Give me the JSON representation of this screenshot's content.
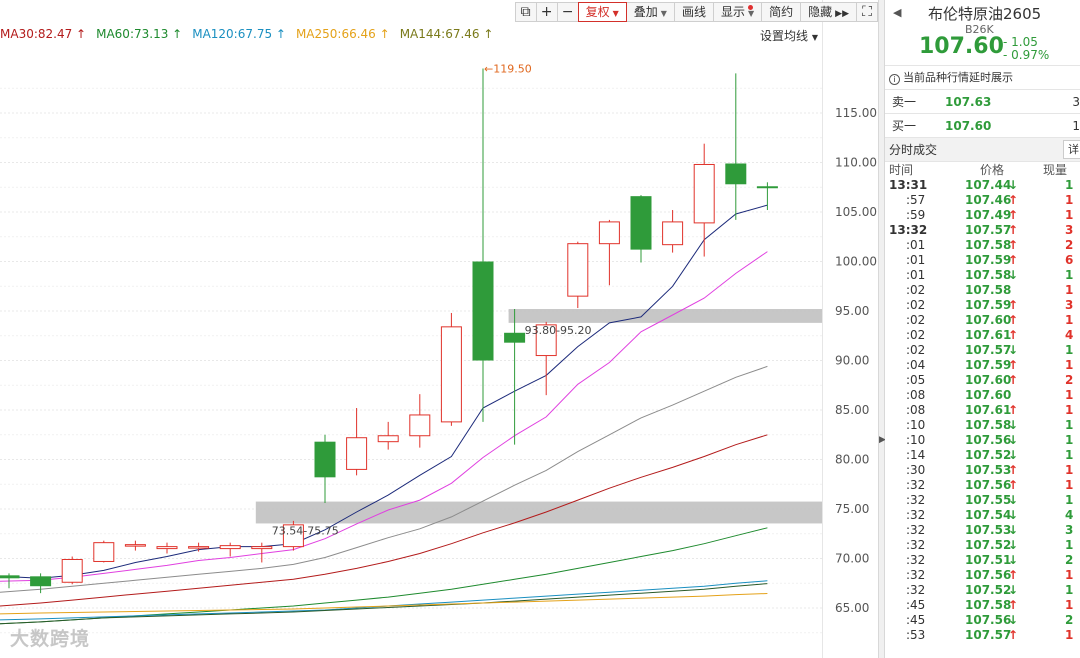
{
  "toolbar": {
    "buttons": [
      "复权",
      "叠加",
      "画线",
      "显示",
      "简约",
      "隐藏"
    ],
    "icons": [
      "copy-icon",
      "zoom-in-icon",
      "zoom-out-icon",
      "double-chevron-right-icon",
      "fullscreen-icon"
    ]
  },
  "ma_legend": [
    {
      "label": "MA30:82.47",
      "arrow": "↑",
      "color": "#b31b1b"
    },
    {
      "label": "MA60:73.13",
      "arrow": "↑",
      "color": "#1e8a2e"
    },
    {
      "label": "MA120:67.75",
      "arrow": "↑",
      "color": "#1a8fc0"
    },
    {
      "label": "MA250:66.46",
      "arrow": "↑",
      "color": "#e4a21a"
    },
    {
      "label": "MA144:67.46",
      "arrow": "↑",
      "color": "#7a7a1a"
    }
  ],
  "ma_settings_label": "设置均线",
  "collapse_glyph": "▶",
  "chart_data": {
    "type": "candlestick",
    "ylim": [
      62,
      122
    ],
    "y_ticks": [
      "115.00",
      "110.00",
      "105.00",
      "100.00",
      "95.00",
      "90.00",
      "85.00",
      "80.00",
      "75.00",
      "70.00",
      "65.00"
    ],
    "y_tick_values": [
      115,
      110,
      105,
      100,
      95,
      90,
      85,
      80,
      75,
      70,
      65
    ],
    "high_annotation": {
      "label": "119.50",
      "arrow": "←",
      "index": 14
    },
    "zones": [
      {
        "label": "93.80-95.20",
        "low": 93.8,
        "high": 95.2,
        "start_index": 16
      },
      {
        "label": "73.54-75.75",
        "low": 73.54,
        "high": 75.75,
        "start_index": 8
      }
    ],
    "candles": [
      {
        "o": 68.3,
        "h": 68.5,
        "l": 67.0,
        "c": 68.0
      },
      {
        "o": 68.2,
        "h": 68.5,
        "l": 66.5,
        "c": 67.2
      },
      {
        "o": 67.6,
        "h": 70.2,
        "l": 67.4,
        "c": 69.9
      },
      {
        "o": 69.7,
        "h": 71.8,
        "l": 69.6,
        "c": 71.6
      },
      {
        "o": 71.4,
        "h": 71.8,
        "l": 70.8,
        "c": 71.4
      },
      {
        "o": 71.0,
        "h": 71.6,
        "l": 70.5,
        "c": 71.2
      },
      {
        "o": 71.1,
        "h": 71.6,
        "l": 70.7,
        "c": 71.2
      },
      {
        "o": 71.0,
        "h": 71.6,
        "l": 70.2,
        "c": 71.3
      },
      {
        "o": 71.0,
        "h": 71.6,
        "l": 69.6,
        "c": 71.2
      },
      {
        "o": 71.2,
        "h": 73.8,
        "l": 70.8,
        "c": 73.4
      },
      {
        "o": 81.8,
        "h": 82.5,
        "l": 75.6,
        "c": 78.2
      },
      {
        "o": 79.0,
        "h": 85.2,
        "l": 78.4,
        "c": 82.2
      },
      {
        "o": 81.8,
        "h": 83.8,
        "l": 81.0,
        "c": 82.4
      },
      {
        "o": 82.4,
        "h": 86.6,
        "l": 81.2,
        "c": 84.5
      },
      {
        "o": 83.8,
        "h": 94.8,
        "l": 83.4,
        "c": 93.4
      },
      {
        "o": 100.0,
        "h": 119.5,
        "l": 83.8,
        "c": 90.0
      },
      {
        "o": 92.8,
        "h": 95.2,
        "l": 81.5,
        "c": 91.8
      },
      {
        "o": 90.5,
        "h": 93.9,
        "l": 86.5,
        "c": 93.6
      },
      {
        "o": 96.5,
        "h": 102.0,
        "l": 95.3,
        "c": 101.8
      },
      {
        "o": 101.8,
        "h": 104.2,
        "l": 97.6,
        "c": 104.0
      },
      {
        "o": 106.6,
        "h": 106.7,
        "l": 99.9,
        "c": 101.2
      },
      {
        "o": 101.7,
        "h": 105.2,
        "l": 100.9,
        "c": 104.0
      },
      {
        "o": 103.9,
        "h": 111.9,
        "l": 100.5,
        "c": 109.8
      },
      {
        "o": 109.9,
        "h": 119.0,
        "l": 104.2,
        "c": 107.8
      },
      {
        "o": 107.6,
        "h": 108.0,
        "l": 105.2,
        "c": 107.4
      }
    ],
    "ma_lines": [
      {
        "name": "MA5",
        "color": "#1c2a7a",
        "values": [
          68.2,
          68.0,
          68.3,
          68.8,
          69.6,
          70.2,
          70.9,
          71.2,
          71.2,
          71.5,
          72.9,
          74.7,
          76.4,
          78.4,
          80.3,
          85.2,
          86.9,
          88.5,
          91.4,
          93.8,
          94.4,
          97.5,
          102.2,
          104.8,
          105.7
        ]
      },
      {
        "name": "MA10",
        "color": "#e040e0",
        "values": [
          67.7,
          67.8,
          68.1,
          68.5,
          68.9,
          69.3,
          69.8,
          70.1,
          70.5,
          70.9,
          72.0,
          73.5,
          74.9,
          75.9,
          77.6,
          80.2,
          82.4,
          84.3,
          87.6,
          89.8,
          92.9,
          94.6,
          96.3,
          98.8,
          101.0
        ]
      },
      {
        "name": "MA20",
        "color": "#8c8c8c",
        "values": [
          66.6,
          66.9,
          67.2,
          67.5,
          67.8,
          68.1,
          68.4,
          68.7,
          69.0,
          69.4,
          70.1,
          71.1,
          72.1,
          73.0,
          74.2,
          75.8,
          77.4,
          78.9,
          80.8,
          82.5,
          84.2,
          85.5,
          86.9,
          88.3,
          89.4
        ]
      },
      {
        "name": "MA30",
        "color": "#b31b1b",
        "values": [
          65.2,
          65.5,
          65.8,
          66.1,
          66.4,
          66.7,
          67.0,
          67.3,
          67.6,
          67.9,
          68.4,
          69.0,
          69.7,
          70.5,
          71.5,
          72.6,
          73.6,
          74.7,
          75.9,
          77.1,
          78.2,
          79.2,
          80.3,
          81.5,
          82.5
        ]
      },
      {
        "name": "MA60",
        "color": "#1e8a2e",
        "values": [
          63.4,
          63.6,
          63.8,
          64.0,
          64.2,
          64.4,
          64.6,
          64.8,
          65.0,
          65.2,
          65.5,
          65.8,
          66.1,
          66.5,
          66.9,
          67.4,
          67.9,
          68.4,
          69.0,
          69.6,
          70.2,
          70.8,
          71.5,
          72.3,
          73.1
        ]
      },
      {
        "name": "MA120",
        "color": "#1a8fc0",
        "values": [
          63.8,
          63.9,
          64.0,
          64.1,
          64.2,
          64.3,
          64.4,
          64.5,
          64.6,
          64.7,
          64.8,
          65.0,
          65.2,
          65.4,
          65.6,
          65.8,
          66.0,
          66.2,
          66.4,
          66.6,
          66.8,
          67.0,
          67.2,
          67.5,
          67.75
        ]
      },
      {
        "name": "MA144",
        "color": "#2a5a2a",
        "values": [
          63.4,
          63.6,
          63.8,
          64.0,
          64.1,
          64.2,
          64.3,
          64.4,
          64.5,
          64.6,
          64.75,
          64.9,
          65.05,
          65.2,
          65.35,
          65.5,
          65.7,
          65.9,
          66.1,
          66.3,
          66.5,
          66.7,
          66.9,
          67.2,
          67.46
        ]
      },
      {
        "name": "MA250",
        "color": "#e4a21a",
        "values": [
          64.4,
          64.5,
          64.55,
          64.6,
          64.65,
          64.7,
          64.75,
          64.8,
          64.85,
          64.9,
          65.0,
          65.1,
          65.2,
          65.3,
          65.4,
          65.5,
          65.6,
          65.7,
          65.8,
          65.9,
          66.0,
          66.1,
          66.2,
          66.35,
          66.46
        ]
      }
    ]
  },
  "panel": {
    "prev_label": "◀",
    "name": "布伦特原油2605",
    "code": "B26K",
    "price": "107.60",
    "change": "- 1.05",
    "change_pct": "- 0.97%",
    "notice": "当前品种行情延时展示",
    "ask": {
      "label": "卖一",
      "price": "107.63",
      "volume": "3"
    },
    "bid": {
      "label": "买一",
      "price": "107.60",
      "volume": "1"
    },
    "ticks_title": "分时成交",
    "ticks_expand": "详",
    "col_time": "时间",
    "col_price": "价格",
    "col_vol": "现量",
    "ticks": [
      {
        "time": "13:31",
        "main": true,
        "price": "107.44",
        "dir": "down",
        "vol": "1"
      },
      {
        "time": ":57",
        "main": false,
        "price": "107.46",
        "dir": "up",
        "vol": "1"
      },
      {
        "time": ":59",
        "main": false,
        "price": "107.49",
        "dir": "up",
        "vol": "1"
      },
      {
        "time": "13:32",
        "main": true,
        "price": "107.57",
        "dir": "up",
        "vol": "3"
      },
      {
        "time": ":01",
        "main": false,
        "price": "107.58",
        "dir": "up",
        "vol": "2"
      },
      {
        "time": ":01",
        "main": false,
        "price": "107.59",
        "dir": "up",
        "vol": "6"
      },
      {
        "time": ":01",
        "main": false,
        "price": "107.58",
        "dir": "down",
        "vol": "1"
      },
      {
        "time": ":02",
        "main": false,
        "price": "107.58",
        "dir": "none",
        "vol": "1"
      },
      {
        "time": ":02",
        "main": false,
        "price": "107.59",
        "dir": "up",
        "vol": "3"
      },
      {
        "time": ":02",
        "main": false,
        "price": "107.60",
        "dir": "up",
        "vol": "1"
      },
      {
        "time": ":02",
        "main": false,
        "price": "107.61",
        "dir": "up",
        "vol": "4"
      },
      {
        "time": ":02",
        "main": false,
        "price": "107.57",
        "dir": "down",
        "vol": "1"
      },
      {
        "time": ":04",
        "main": false,
        "price": "107.59",
        "dir": "up",
        "vol": "1"
      },
      {
        "time": ":05",
        "main": false,
        "price": "107.60",
        "dir": "up",
        "vol": "2"
      },
      {
        "time": ":08",
        "main": false,
        "price": "107.60",
        "dir": "none",
        "vol": "1"
      },
      {
        "time": ":08",
        "main": false,
        "price": "107.61",
        "dir": "up",
        "vol": "1"
      },
      {
        "time": ":10",
        "main": false,
        "price": "107.58",
        "dir": "down",
        "vol": "1"
      },
      {
        "time": ":10",
        "main": false,
        "price": "107.56",
        "dir": "down",
        "vol": "1"
      },
      {
        "time": ":14",
        "main": false,
        "price": "107.52",
        "dir": "down",
        "vol": "1"
      },
      {
        "time": ":30",
        "main": false,
        "price": "107.53",
        "dir": "up",
        "vol": "1"
      },
      {
        "time": ":32",
        "main": false,
        "price": "107.56",
        "dir": "up",
        "vol": "1"
      },
      {
        "time": ":32",
        "main": false,
        "price": "107.55",
        "dir": "down",
        "vol": "1"
      },
      {
        "time": ":32",
        "main": false,
        "price": "107.54",
        "dir": "down",
        "vol": "4"
      },
      {
        "time": ":32",
        "main": false,
        "price": "107.53",
        "dir": "down",
        "vol": "3"
      },
      {
        "time": ":32",
        "main": false,
        "price": "107.52",
        "dir": "down",
        "vol": "1"
      },
      {
        "time": ":32",
        "main": false,
        "price": "107.51",
        "dir": "down",
        "vol": "2"
      },
      {
        "time": ":32",
        "main": false,
        "price": "107.56",
        "dir": "up",
        "vol": "1"
      },
      {
        "time": ":32",
        "main": false,
        "price": "107.52",
        "dir": "down",
        "vol": "1"
      },
      {
        "time": ":45",
        "main": false,
        "price": "107.58",
        "dir": "up",
        "vol": "1"
      },
      {
        "time": ":45",
        "main": false,
        "price": "107.56",
        "dir": "down",
        "vol": "2"
      },
      {
        "time": ":53",
        "main": false,
        "price": "107.57",
        "dir": "up",
        "vol": "1"
      }
    ]
  },
  "colors": {
    "up": "#e0322a",
    "down": "#2f9b3a",
    "zone": "#bdbdbd"
  },
  "watermark": "大数跨境"
}
